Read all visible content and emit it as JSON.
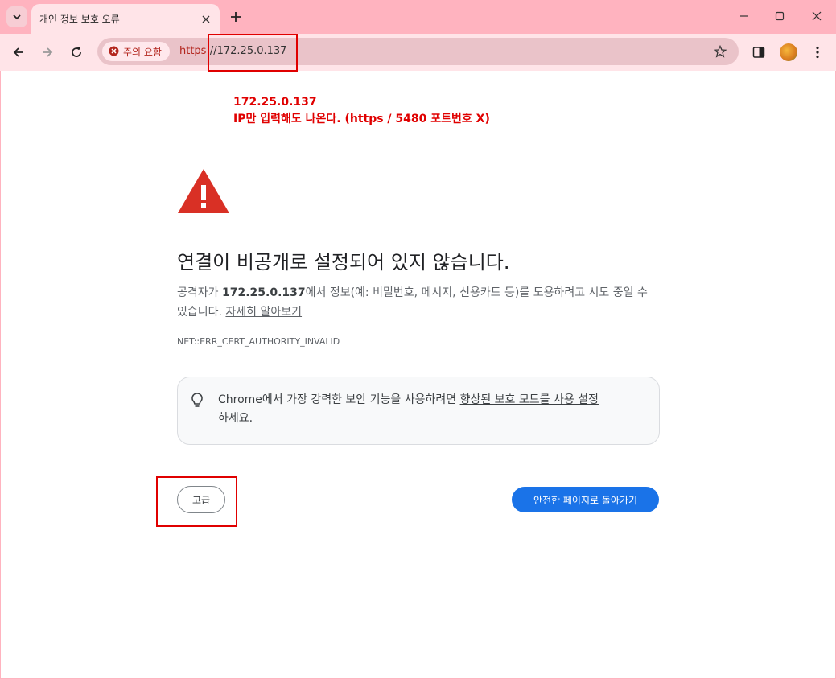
{
  "tab": {
    "title": "개인 정보 보호 오류"
  },
  "omnibox": {
    "chip_label": "주의 요함",
    "url_scheme": "https",
    "url_rest": "://172.25.0.137"
  },
  "annotation": {
    "line1": "172.25.0.137",
    "line2": "IP만 입력해도 나온다. (https / 5480 포트번호 X)"
  },
  "page": {
    "headline": "연결이 비공개로 설정되어 있지 않습니다.",
    "desc_prefix": "공격자가 ",
    "desc_host": "172.25.0.137",
    "desc_suffix": "에서 정보(예: 비밀번호, 메시지, 신용카드 등)를 도용하려고 시도 중일 수 있습니다. ",
    "learn_more": "자세히 알아보기",
    "error_code": "NET::ERR_CERT_AUTHORITY_INVALID",
    "tip_prefix": "Chrome에서 가장 강력한 보안 기능을 사용하려면 ",
    "tip_link": "향상된 보호 모드를 사용 설정",
    "tip_suffix": "하세요.",
    "advanced_button": "고급",
    "back_button": "안전한 페이지로 돌아가기"
  },
  "colors": {
    "frame": "#ffb3bf",
    "toolbar": "#ffe4e8",
    "warning": "#d93025",
    "primary": "#1a73e8",
    "annotation": "#e00000"
  },
  "icons": [
    "tab-search-icon",
    "close-icon",
    "new-tab-icon",
    "minimize-icon",
    "maximize-icon",
    "back-icon",
    "forward-icon",
    "reload-icon",
    "not-secure-icon",
    "bookmark-star-icon",
    "side-panel-icon",
    "profile-avatar",
    "menu-icon",
    "warning-triangle-icon",
    "lightbulb-icon"
  ]
}
